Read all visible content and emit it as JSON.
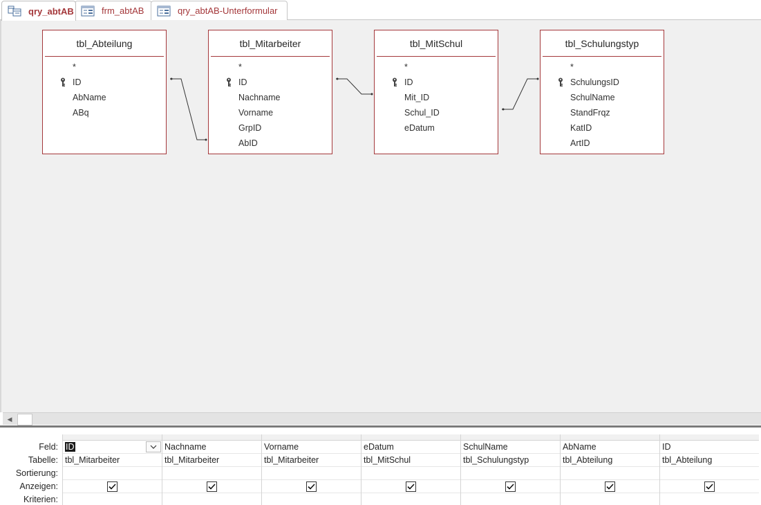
{
  "tabs": [
    {
      "label": "qry_abtAB",
      "active": true,
      "icon": "query-icon"
    },
    {
      "label": "frm_abtAB",
      "active": false,
      "icon": "form-icon"
    },
    {
      "label": "qry_abtAB-Unterformular",
      "active": false,
      "icon": "form-icon"
    }
  ],
  "tables": [
    {
      "name": "tbl_Abteilung",
      "fields": [
        "*",
        "ID",
        "AbName",
        "ABq"
      ],
      "key_field": "ID"
    },
    {
      "name": "tbl_Mitarbeiter",
      "fields": [
        "*",
        "ID",
        "Nachname",
        "Vorname",
        "GrpID",
        "AbID"
      ],
      "key_field": "ID"
    },
    {
      "name": "tbl_MitSchul",
      "fields": [
        "*",
        "ID",
        "Mit_ID",
        "Schul_ID",
        "eDatum"
      ],
      "key_field": "ID"
    },
    {
      "name": "tbl_Schulungstyp",
      "fields": [
        "*",
        "SchulungsID",
        "SchulName",
        "StandFrqz",
        "KatID",
        "ArtID"
      ],
      "key_field": "SchulungsID"
    }
  ],
  "grid": {
    "row_labels": {
      "field": "Feld:",
      "table": "Tabelle:",
      "sort": "Sortierung:",
      "show": "Anzeigen:",
      "criteria": "Kriterien:"
    },
    "columns": [
      {
        "field": "ID",
        "table": "tbl_Mitarbeiter",
        "show": true
      },
      {
        "field": "Nachname",
        "table": "tbl_Mitarbeiter",
        "show": true
      },
      {
        "field": "Vorname",
        "table": "tbl_Mitarbeiter",
        "show": true
      },
      {
        "field": "eDatum",
        "table": "tbl_MitSchul",
        "show": true
      },
      {
        "field": "SchulName",
        "table": "tbl_Schulungstyp",
        "show": true
      },
      {
        "field": "AbName",
        "table": "tbl_Abteilung",
        "show": true
      },
      {
        "field": "ID",
        "table": "tbl_Abteilung",
        "show": true
      }
    ]
  },
  "colors": {
    "accent": "#a4373a",
    "surface": "#f0f0f0"
  }
}
